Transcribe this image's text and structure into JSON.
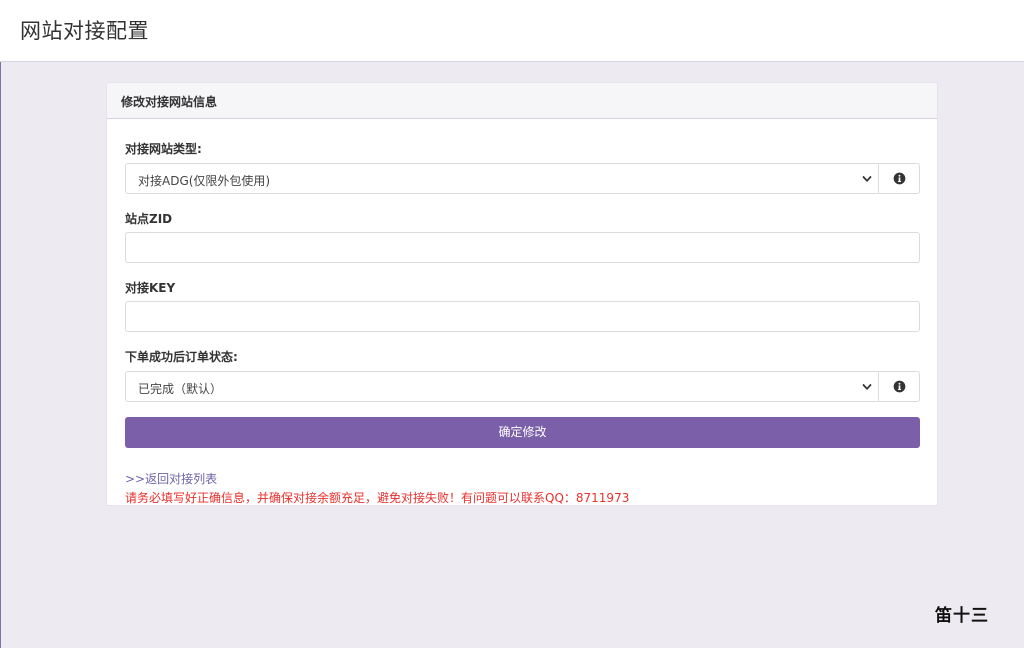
{
  "header": {
    "title": "网站对接配置"
  },
  "panel": {
    "heading": "修改对接网站信息",
    "site_type": {
      "label": "对接网站类型:",
      "selected": "对接ADG(仅限外包使用)"
    },
    "site_zid": {
      "label": "站点ZID",
      "value": "",
      "placeholder": ""
    },
    "api_key": {
      "label": "对接KEY",
      "value": "",
      "placeholder": ""
    },
    "order_status": {
      "label": "下单成功后订单状态:",
      "selected": "已完成（默认）"
    },
    "submit_label": "确定修改",
    "back_link": ">>返回对接列表",
    "warning": "请务必填写好正确信息，并确保对接余额充足，避免对接失败！有问题可以联系QQ：8711973"
  },
  "watermark": "笛十三",
  "colors": {
    "accent": "#7b5fa9",
    "warning": "#e8302d",
    "link": "#6f63a8",
    "background": "#edebf1"
  },
  "icons": {
    "select_arrow": "chevron-down-icon",
    "help": "info-icon"
  }
}
